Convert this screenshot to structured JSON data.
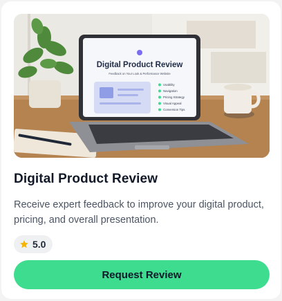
{
  "card": {
    "image": {
      "screen_heading": "Digital Product Review",
      "screen_subheading": "Feedback on Your Look & Performance Website",
      "checklist": [
        "Usability",
        "Navigation",
        "Pricing Strategy",
        "Visual Appeal",
        "Conversion Tips"
      ]
    },
    "title": "Digital Product Review",
    "description": "Receive expert feedback to improve your digital product, pricing, and overall presentation.",
    "rating": {
      "icon": "star-icon",
      "value": "5.0",
      "color": "#f5b400"
    },
    "cta_label": "Request Review",
    "accent": "#3ddc8e"
  }
}
